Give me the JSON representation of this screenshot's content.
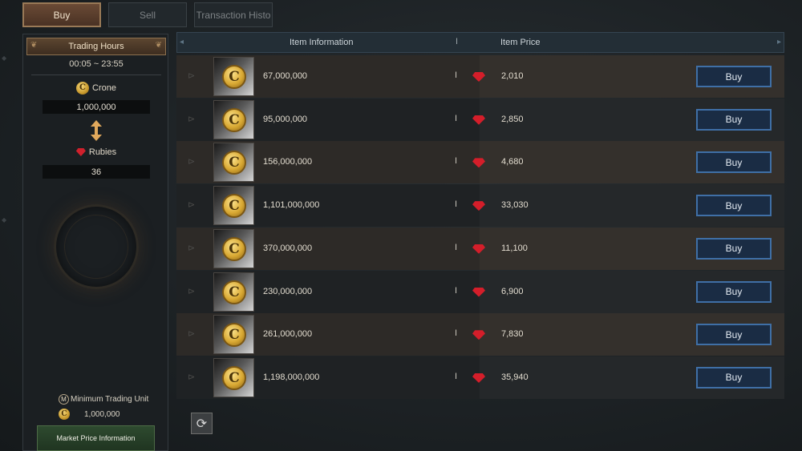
{
  "tabs": [
    {
      "label": "Buy",
      "active": true
    },
    {
      "label": "Sell",
      "active": false
    },
    {
      "label": "Transaction Histo",
      "active": false
    }
  ],
  "left_panel": {
    "trading_hours_label": "Trading Hours",
    "trading_hours_value": "00:05 ~ 23:55",
    "crone_label": "Crone",
    "crone_value": "1,000,000",
    "rubies_label": "Rubies",
    "rubies_value": "36",
    "min_trading_unit_label": "Minimum Trading Unit",
    "min_trading_unit_value": "1,000,000",
    "market_price_button": "Market Price Information"
  },
  "table": {
    "header_item": "Item Information",
    "header_price": "Item Price",
    "separator": "I",
    "buy_label": "Buy",
    "coin_glyph": "C",
    "rows": [
      {
        "amount": "67,000,000",
        "price": "2,010"
      },
      {
        "amount": "95,000,000",
        "price": "2,850"
      },
      {
        "amount": "156,000,000",
        "price": "4,680"
      },
      {
        "amount": "1,101,000,000",
        "price": "33,030"
      },
      {
        "amount": "370,000,000",
        "price": "11,100"
      },
      {
        "amount": "230,000,000",
        "price": "6,900"
      },
      {
        "amount": "261,000,000",
        "price": "7,830"
      },
      {
        "amount": "1,198,000,000",
        "price": "35,940"
      }
    ]
  },
  "icons": {
    "coin": "crone-coin-icon",
    "ruby": "ruby-icon",
    "refresh": "refresh-icon",
    "swap": "swap-arrow-icon"
  },
  "colors": {
    "buy_button_border": "#3f6fa6",
    "active_tab": "#6a4a35",
    "market_button": "#2e4a2f",
    "ruby": "#d41e2a",
    "coin": "#d9a933"
  }
}
